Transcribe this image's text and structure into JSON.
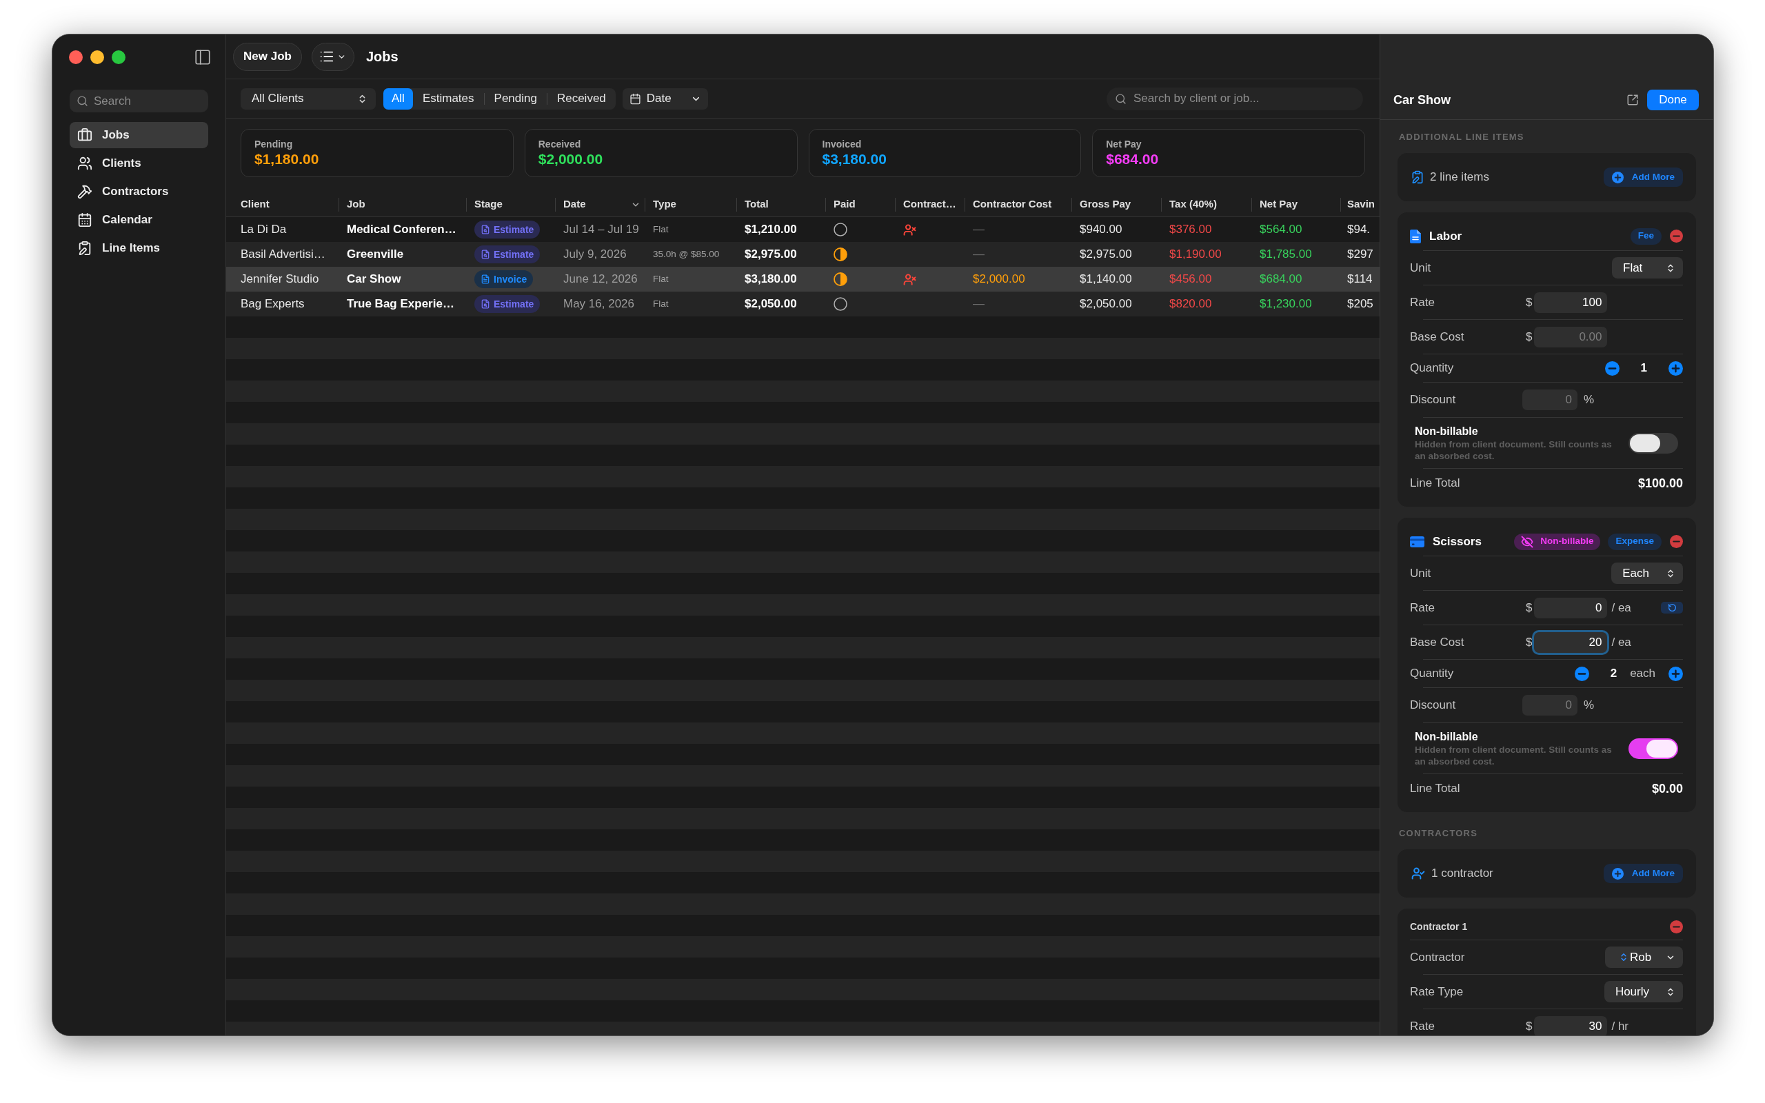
{
  "sidebar": {
    "search": {
      "placeholder": "Search"
    },
    "items": [
      {
        "label": "Jobs",
        "selected": true
      },
      {
        "label": "Clients",
        "selected": false
      },
      {
        "label": "Contractors",
        "selected": false
      },
      {
        "label": "Calendar",
        "selected": false
      },
      {
        "label": "Line Items",
        "selected": false
      }
    ]
  },
  "toolbar": {
    "new_button": "New Job",
    "title": "Jobs"
  },
  "filters": {
    "client_select": "All Clients",
    "segments": [
      {
        "label": "All",
        "selected": true
      },
      {
        "label": "Estimates",
        "selected": false
      },
      {
        "label": "Pending",
        "selected": false
      },
      {
        "label": "Received",
        "selected": false
      }
    ],
    "sort_select": "Date",
    "search": {
      "placeholder": "Search by client or job..."
    }
  },
  "summary_cards": [
    {
      "label": "Pending",
      "value": "$1,180.00",
      "color": "#ff9f0a"
    },
    {
      "label": "Received",
      "value": "$2,000.00",
      "color": "#2fe05c"
    },
    {
      "label": "Invoiced",
      "value": "$3,180.00",
      "color": "#11a6ff"
    },
    {
      "label": "Net Pay",
      "value": "$684.00",
      "color": "#f53df7"
    }
  ],
  "table": {
    "columns": [
      {
        "label": "Client",
        "sorted": false
      },
      {
        "label": "Job",
        "sorted": false
      },
      {
        "label": "Stage",
        "sorted": false
      },
      {
        "label": "Date",
        "sorted": true
      },
      {
        "label": "Type",
        "sorted": false
      },
      {
        "label": "Total",
        "sorted": false
      },
      {
        "label": "Paid",
        "sorted": false
      },
      {
        "label": "Contract…",
        "sorted": false
      },
      {
        "label": "Contractor Cost",
        "sorted": false
      },
      {
        "label": "Gross Pay",
        "sorted": false
      },
      {
        "label": "Tax (40%)",
        "sorted": false
      },
      {
        "label": "Net Pay",
        "sorted": false
      },
      {
        "label": "Savin",
        "sorted": false
      }
    ],
    "rows": [
      {
        "selected": false,
        "client": "La Di Da",
        "job": "Medical Conferen…",
        "stage": {
          "label": "Estimate",
          "kind": "estimate"
        },
        "date": "Jul 14 – Jul 19",
        "type": "Flat",
        "total": "$1,210.00",
        "paid": {
          "kind": "unpaid"
        },
        "contractor_alert": true,
        "contractor_cost": {
          "text": "—",
          "kind": "none"
        },
        "gross_pay": "$940.00",
        "tax": "$376.00",
        "net_pay": "$564.00",
        "column_13": "$94."
      },
      {
        "selected": false,
        "client": "Basil Advertisi…",
        "job": "Greenville",
        "stage": {
          "label": "Estimate",
          "kind": "estimate"
        },
        "date": "July 9, 2026",
        "type": "35.0h @ $85.00",
        "total": "$2,975.00",
        "paid": {
          "kind": "partial"
        },
        "contractor_alert": false,
        "contractor_cost": {
          "text": "—",
          "kind": "none"
        },
        "gross_pay": "$2,975.00",
        "tax": "$1,190.00",
        "net_pay": "$1,785.00",
        "column_13": "$297"
      },
      {
        "selected": true,
        "client": "Jennifer Studio",
        "job": "Car Show",
        "stage": {
          "label": "Invoice",
          "kind": "invoice"
        },
        "date": "June 12, 2026",
        "type": "Flat",
        "total": "$3,180.00",
        "paid": {
          "kind": "partial"
        },
        "contractor_alert": true,
        "contractor_cost": {
          "text": "$2,000.00",
          "kind": "amount"
        },
        "gross_pay": "$1,140.00",
        "tax": "$456.00",
        "net_pay": "$684.00",
        "column_13": "$114"
      },
      {
        "selected": false,
        "client": "Bag Experts",
        "job": "True Bag Experie…",
        "stage": {
          "label": "Estimate",
          "kind": "estimate"
        },
        "date": "May 16, 2026",
        "type": "Flat",
        "total": "$2,050.00",
        "paid": {
          "kind": "unpaid"
        },
        "contractor_alert": false,
        "contractor_cost": {
          "text": "—",
          "kind": "none"
        },
        "gross_pay": "$2,050.00",
        "tax": "$820.00",
        "net_pay": "$1,230.00",
        "column_13": "$205"
      }
    ]
  },
  "detail_panel": {
    "title": "Car Show",
    "done_button": "Done",
    "line_items": {
      "heading": "ADDITIONAL LINE ITEMS",
      "summary": "2 line items",
      "add_button": "Add More",
      "items": [
        {
          "name": "Labor",
          "kind": "fee",
          "badges": [
            {
              "label": "Fee",
              "kind": "type"
            }
          ],
          "rows": [
            {
              "kind": "select",
              "label": "Unit",
              "value": "Flat"
            },
            {
              "kind": "money",
              "label": "Rate",
              "currency": "$",
              "value": "100",
              "focused": false,
              "reset_button": false
            },
            {
              "kind": "money",
              "label": "Base Cost",
              "currency": "$",
              "placeholder": "0.00",
              "focused": false,
              "reset_button": false
            },
            {
              "kind": "stepper",
              "label": "Quantity",
              "value": "1"
            },
            {
              "kind": "percent",
              "label": "Discount",
              "placeholder": "0",
              "unit": "%"
            },
            {
              "kind": "toggle",
              "label": "Non-billable",
              "description": "Hidden from client document. Still counts as an absorbed cost.",
              "on": false
            },
            {
              "kind": "total",
              "label": "Line Total",
              "value": "$100.00"
            }
          ]
        },
        {
          "name": "Scissors",
          "kind": "expense",
          "badges": [
            {
              "label": "Non-billable",
              "kind": "nonbillable"
            },
            {
              "label": "Expense",
              "kind": "type"
            }
          ],
          "rows": [
            {
              "kind": "select",
              "label": "Unit",
              "value": "Each"
            },
            {
              "kind": "money",
              "label": "Rate",
              "currency": "$",
              "value": "0",
              "suffix": "/ ea",
              "focused": false,
              "reset_button": true
            },
            {
              "kind": "money",
              "label": "Base Cost",
              "currency": "$",
              "value": "20",
              "suffix": "/ ea",
              "focused": true,
              "reset_button": false
            },
            {
              "kind": "stepper",
              "label": "Quantity",
              "value": "2",
              "unit": "each"
            },
            {
              "kind": "percent",
              "label": "Discount",
              "placeholder": "0",
              "unit": "%"
            },
            {
              "kind": "toggle",
              "label": "Non-billable",
              "description": "Hidden from client document. Still counts as an absorbed cost.",
              "on": true
            },
            {
              "kind": "total",
              "label": "Line Total",
              "value": "$0.00"
            }
          ]
        }
      ]
    },
    "contractors": {
      "heading": "CONTRACTORS",
      "summary": "1 contractor",
      "add_button": "Add More",
      "items": [
        {
          "title": "Contractor 1",
          "rows": [
            {
              "kind": "picker",
              "label": "Contractor",
              "value": "Rob"
            },
            {
              "kind": "select",
              "label": "Rate Type",
              "value": "Hourly"
            },
            {
              "kind": "money",
              "label": "Rate",
              "currency": "$",
              "value": "30",
              "suffix": "/ hr",
              "focused": false,
              "reset_button": false
            }
          ]
        }
      ]
    }
  }
}
